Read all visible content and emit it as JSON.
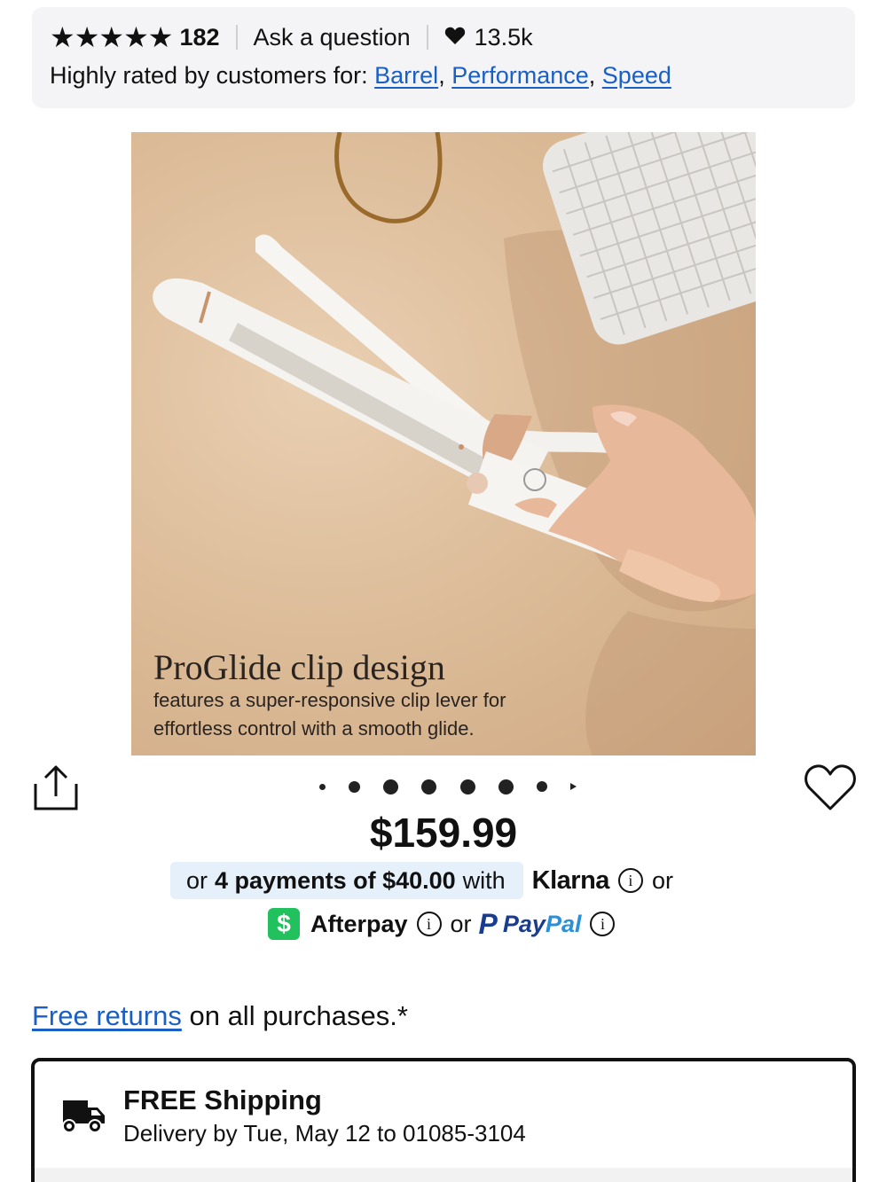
{
  "ratings": {
    "stars": "★★★★★",
    "review_count": "182",
    "ask_question": "Ask a question",
    "loves_count": "13.5k",
    "highly_rated_prefix": "Highly rated by customers for:",
    "tags": [
      "Barrel",
      "Performance",
      "Speed"
    ]
  },
  "product_image": {
    "caption_title": "ProGlide clip design",
    "caption_body": "features a super-responsive clip lever for effortless control with a smooth glide."
  },
  "carousel": {
    "dot_count": 8,
    "active_index": 0
  },
  "price": {
    "amount": "$159.99"
  },
  "payments": {
    "klarna_prefix": "or",
    "klarna_bold": "4 payments of $40.00",
    "klarna_suffix": "with",
    "klarna_name": "Klarna",
    "or_1": "or",
    "afterpay_name": "Afterpay",
    "or_2": "or",
    "paypal_name_1": "Pay",
    "paypal_name_2": "Pal"
  },
  "returns": {
    "link": "Free returns",
    "text": "on all purchases.*"
  },
  "shipping": {
    "title": "FREE Shipping",
    "subtitle": "Delivery by Tue, May 12 to 01085-3104"
  },
  "colors": {
    "link": "#1a5fc4",
    "klarna_pill": "#e6f0fb",
    "cash_app_green": "#21c25e",
    "paypal_dark": "#1a3c8f",
    "paypal_light": "#2a90d8"
  },
  "icons": {
    "share": "share-icon",
    "wishlist": "heart-outline-icon",
    "loves": "heart-filled-icon",
    "truck": "truck-icon",
    "info": "info-icon"
  }
}
